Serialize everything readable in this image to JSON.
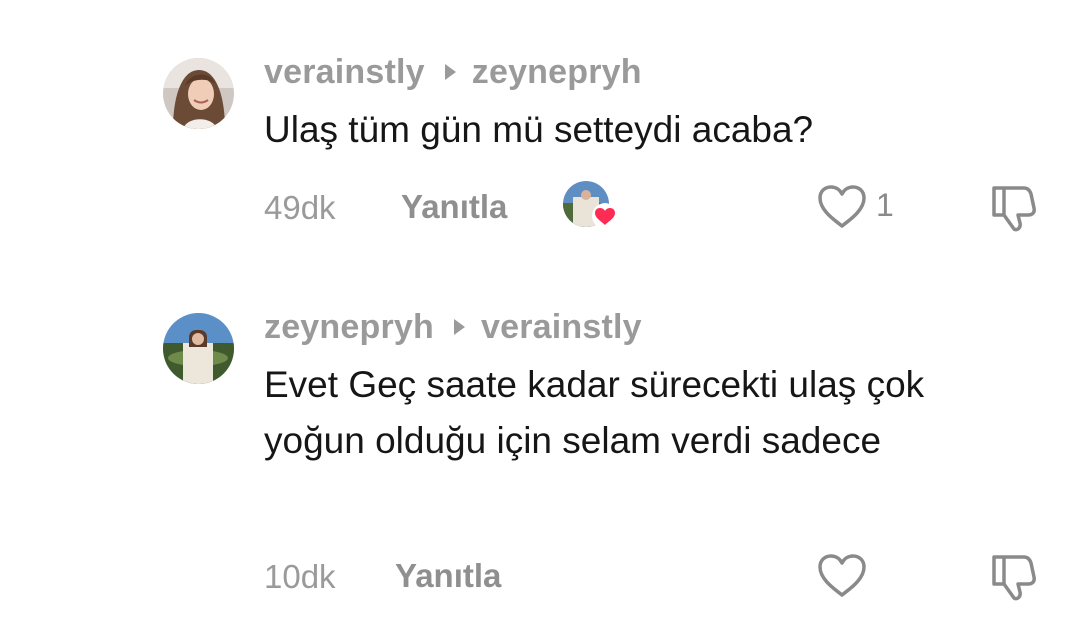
{
  "comments": [
    {
      "author": "verainstly",
      "reply_to": "zeynepryh",
      "text": "Ulaş tüm gün mü setteydi acaba?",
      "time": "49dk",
      "reply_label": "Yanıtla",
      "like_count": "1",
      "liked_by_creator": true
    },
    {
      "author": "zeynepryh",
      "reply_to": "verainstly",
      "text": "Evet Geç saate kadar sürecekti ulaş çok yoğun olduğu için selam verdi sadece",
      "time": "10dk",
      "reply_label": "Yanıtla",
      "like_count": "",
      "liked_by_creator": false
    }
  ],
  "colors": {
    "muted_text": "#9a9a9a",
    "body_text": "#161616",
    "heart_badge": "#fe2c55",
    "icon_stroke": "#8a8a8a"
  },
  "icons": [
    "reply-arrow-icon",
    "heart-icon",
    "thumbs-down-icon",
    "creator-liked-heart-icon"
  ]
}
